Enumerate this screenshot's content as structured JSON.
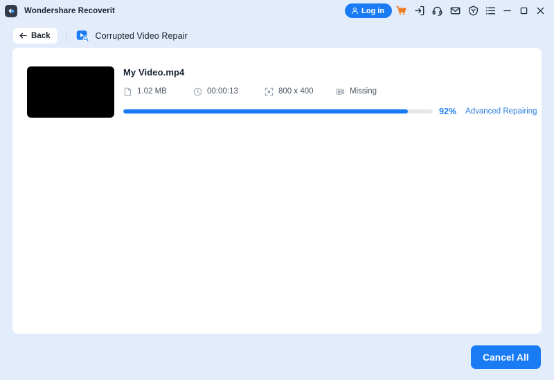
{
  "titlebar": {
    "app_name": "Wondershare Recoverit",
    "logo_icon": "wondershare-logo-icon",
    "login_label": "Log in",
    "login_icon": "user-icon",
    "actions": [
      {
        "name": "cart-icon",
        "label": "Cart"
      },
      {
        "name": "sign-in-arrow-icon",
        "label": "Sign in"
      },
      {
        "name": "headset-support-icon",
        "label": "Support"
      },
      {
        "name": "mail-icon",
        "label": "Feedback"
      },
      {
        "name": "shield-badge-icon",
        "label": "Security"
      },
      {
        "name": "menu-list-icon",
        "label": "Menu"
      },
      {
        "name": "minimize-icon",
        "label": "Minimize"
      },
      {
        "name": "maximize-icon",
        "label": "Maximize"
      },
      {
        "name": "close-icon",
        "label": "Close"
      }
    ]
  },
  "breadcrumb": {
    "back_label": "Back",
    "back_icon": "arrow-left-icon",
    "module_icon": "video-repair-icon",
    "module_title": "Corrupted Video Repair"
  },
  "file": {
    "thumbnail": "video-thumbnail",
    "name": "My Video.mp4",
    "meta": [
      {
        "icon": "file-document-icon",
        "value": "1.02  MB"
      },
      {
        "icon": "clock-icon",
        "value": "00:00:13"
      },
      {
        "icon": "resolution-expand-icon",
        "value": "800 x 400"
      },
      {
        "icon": "video-frame-icon",
        "value": "Missing"
      }
    ],
    "progress": {
      "percent_value": 92,
      "percent_label": "92%",
      "status_link": "Advanced Repairing"
    }
  },
  "footer": {
    "cancel_all_label": "Cancel All"
  },
  "colors": {
    "window_background": "#e2ecfb",
    "card_background": "#ffffff",
    "accent_blue": "#1a7cf5",
    "link_blue": "#2b7de0",
    "cart_orange": "#f07c22",
    "progress_track": "#e6e8eb",
    "logo_dark": "#323c4e"
  }
}
